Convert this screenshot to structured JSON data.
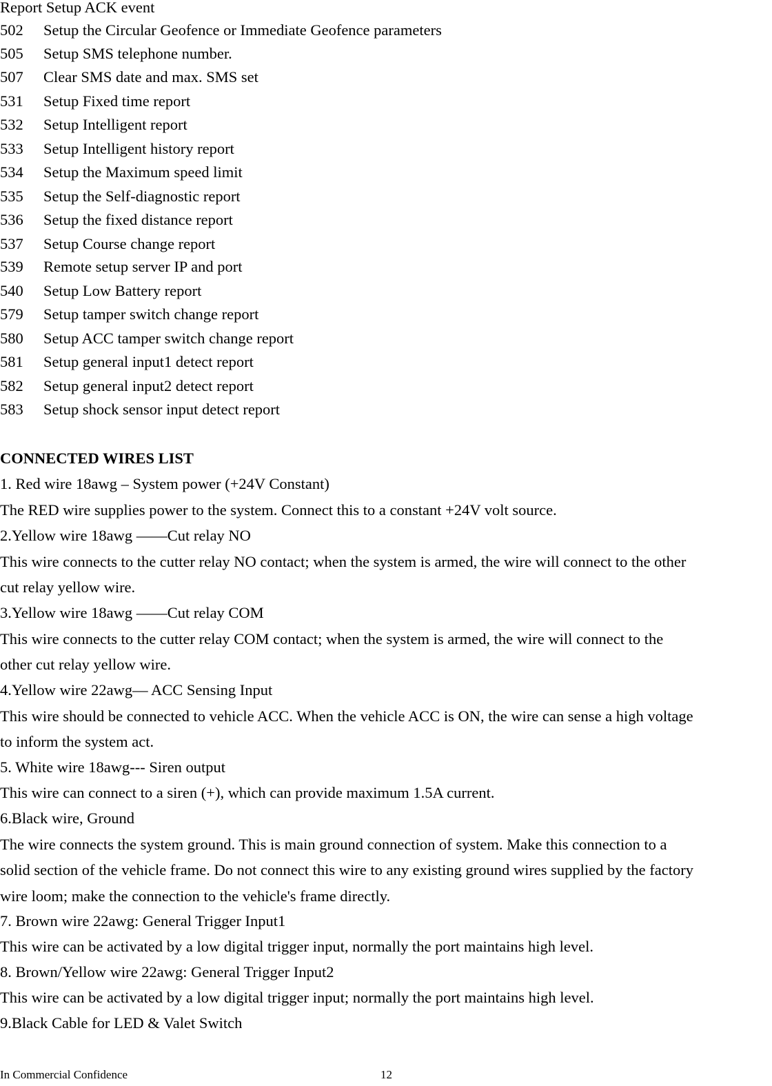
{
  "top_line": "Report Setup ACK event",
  "codes": [
    {
      "code": "502",
      "desc": "Setup the Circular Geofence or Immediate Geofence parameters"
    },
    {
      "code": "505",
      "desc": "Setup SMS telephone number."
    },
    {
      "code": "507",
      "desc": "Clear SMS date and max. SMS set"
    },
    {
      "code": "531",
      "desc": "Setup Fixed time report"
    },
    {
      "code": "532",
      "desc": "Setup Intelligent report"
    },
    {
      "code": "533",
      "desc": "Setup Intelligent history report"
    },
    {
      "code": "534",
      "desc": "Setup the Maximum speed limit"
    },
    {
      "code": "535",
      "desc": "Setup the Self-diagnostic report"
    },
    {
      "code": "536",
      "desc": "Setup the fixed distance report"
    },
    {
      "code": "537",
      "desc": "Setup Course change report"
    },
    {
      "code": "539",
      "desc": "Remote setup server IP and port"
    },
    {
      "code": "540",
      "desc": "Setup Low Battery report"
    },
    {
      "code": "579",
      "desc": "Setup tamper switch change report"
    },
    {
      "code": "580",
      "desc": "Setup ACC tamper switch change report"
    },
    {
      "code": "581",
      "desc": "Setup general input1 detect report"
    },
    {
      "code": "582",
      "desc": "Setup general input2 detect report"
    },
    {
      "code": "583",
      "desc": "Setup shock sensor input detect report"
    }
  ],
  "wires_section": {
    "heading": "CONNECTED WIRES LIST",
    "lines": [
      "1. Red wire 18awg – System power (+24V Constant)",
      "The RED wire supplies power to the system. Connect this to a constant +24V volt source.",
      "2.Yellow wire 18awg ——Cut relay NO",
      "This wire connects to the cutter relay NO contact; when the system is armed, the wire will connect to the other",
      "cut relay yellow wire.",
      "3.Yellow wire 18awg ——Cut relay COM",
      "This wire connects to the cutter relay COM contact; when the system is armed, the wire will connect to the",
      "other cut relay yellow wire.",
      "4.Yellow wire 22awg— ACC Sensing Input",
      "This wire should be connected to vehicle ACC. When the vehicle ACC is ON, the wire can sense a high voltage",
      "to inform the system act.",
      "5. White wire 18awg--- Siren output",
      "This wire can connect to a siren (+), which can provide maximum 1.5A current.",
      "6.Black wire, Ground",
      "The wire connects the system ground. This is main ground connection of system. Make this connection to a",
      "solid section of the vehicle frame. Do not connect this wire to any existing ground wires supplied by the factory",
      "wire loom; make the connection to the vehicle's frame directly.",
      "7. Brown wire 22awg: General Trigger Input1",
      "This wire can be activated by a low digital trigger input, normally the port maintains high level.",
      "8. Brown/Yellow wire 22awg: General Trigger Input2",
      "This wire can be activated by a low digital trigger input; normally the port maintains high level.",
      "9.Black Cable for LED & Valet Switch"
    ]
  },
  "footer": {
    "confidentiality": "In Commercial Confidence",
    "page_number": "12"
  }
}
